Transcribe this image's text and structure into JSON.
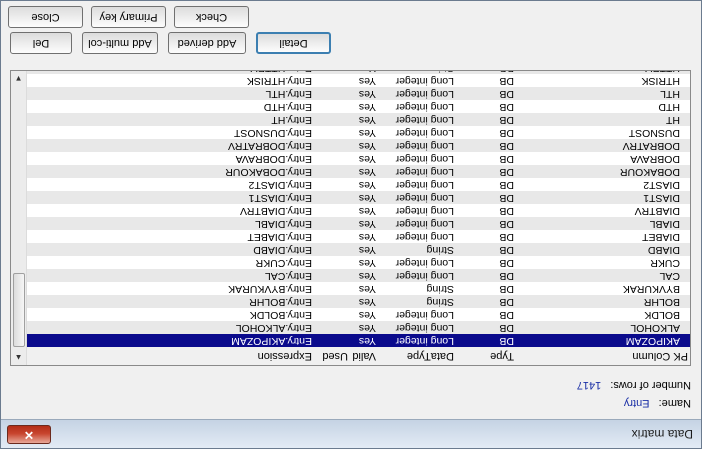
{
  "window": {
    "title": "Data matrix",
    "close_glyph": "✕"
  },
  "info": {
    "name_label": "Name:",
    "name_value": "Entry",
    "rows_label": "Number of rows:",
    "rows_value": "1417"
  },
  "columns": {
    "name": "PK  Column",
    "type": "Type",
    "datatype": "DataType",
    "valid": "Valid",
    "used": "Used",
    "expression": "Expression"
  },
  "rows": [
    {
      "name": "AKIPOZAM",
      "type": "DB",
      "datatype": "Long integer",
      "valid": "Yes",
      "used": "",
      "expression": "Entry.AKIPOZAM",
      "selected": true
    },
    {
      "name": "ALKOHOL",
      "type": "DB",
      "datatype": "Long integer",
      "valid": "Yes",
      "used": "",
      "expression": "Entry.ALKOHOL"
    },
    {
      "name": "BOLDK",
      "type": "DB",
      "datatype": "Long integer",
      "valid": "Yes",
      "used": "",
      "expression": "Entry.BOLDK"
    },
    {
      "name": "BOLHR",
      "type": "DB",
      "datatype": "String",
      "valid": "Yes",
      "used": "",
      "expression": "Entry.BOLHR"
    },
    {
      "name": "BYVKURAK",
      "type": "DB",
      "datatype": "String",
      "valid": "Yes",
      "used": "",
      "expression": "Entry.BYVKURAK"
    },
    {
      "name": "CAL",
      "type": "DB",
      "datatype": "Long integer",
      "valid": "Yes",
      "used": "",
      "expression": "Entry.CAL"
    },
    {
      "name": "CUKR",
      "type": "DB",
      "datatype": "Long integer",
      "valid": "Yes",
      "used": "",
      "expression": "Entry.CUKR"
    },
    {
      "name": "DIABD",
      "type": "DB",
      "datatype": "String",
      "valid": "Yes",
      "used": "",
      "expression": "Entry.DIABD"
    },
    {
      "name": "DIABET",
      "type": "DB",
      "datatype": "Long integer",
      "valid": "Yes",
      "used": "",
      "expression": "Entry.DIABET"
    },
    {
      "name": "DIABL",
      "type": "DB",
      "datatype": "Long integer",
      "valid": "Yes",
      "used": "",
      "expression": "Entry.DIABL"
    },
    {
      "name": "DIABTRV",
      "type": "DB",
      "datatype": "Long integer",
      "valid": "Yes",
      "used": "",
      "expression": "Entry.DIABTRV"
    },
    {
      "name": "DIAST1",
      "type": "DB",
      "datatype": "Long integer",
      "valid": "Yes",
      "used": "",
      "expression": "Entry.DIAST1"
    },
    {
      "name": "DIAST2",
      "type": "DB",
      "datatype": "Long integer",
      "valid": "Yes",
      "used": "",
      "expression": "Entry.DIAST2"
    },
    {
      "name": "DOBAKOUR",
      "type": "DB",
      "datatype": "Long integer",
      "valid": "Yes",
      "used": "",
      "expression": "Entry.DOBAKOUR"
    },
    {
      "name": "DOBRAVA",
      "type": "DB",
      "datatype": "Long integer",
      "valid": "Yes",
      "used": "",
      "expression": "Entry.DOBRAVA"
    },
    {
      "name": "DOBRATRV",
      "type": "DB",
      "datatype": "Long integer",
      "valid": "Yes",
      "used": "",
      "expression": "Entry.DOBRATRV"
    },
    {
      "name": "DUSNOST",
      "type": "DB",
      "datatype": "Long integer",
      "valid": "Yes",
      "used": "",
      "expression": "Entry.DUSNOST"
    },
    {
      "name": "HT",
      "type": "DB",
      "datatype": "Long integer",
      "valid": "Yes",
      "used": "",
      "expression": "Entry.HT"
    },
    {
      "name": "HTD",
      "type": "DB",
      "datatype": "Long integer",
      "valid": "Yes",
      "used": "",
      "expression": "Entry.HTD"
    },
    {
      "name": "HTL",
      "type": "DB",
      "datatype": "Long integer",
      "valid": "Yes",
      "used": "",
      "expression": "Entry.HTL"
    },
    {
      "name": "HTRISK",
      "type": "DB",
      "datatype": "Long integer",
      "valid": "Yes",
      "used": "",
      "expression": "Entry.HTRISK"
    },
    {
      "name": "HTTRV",
      "type": "DB",
      "datatype": "String",
      "valid": "Yes",
      "used": "",
      "expression": "Entry.HTTRV"
    }
  ],
  "buttons": {
    "detail": "Detail",
    "add_derived": "Add derived",
    "add_multi_col": "Add multi-col",
    "del": "Del",
    "close": "Close",
    "primary_key": "Primary key",
    "check": "Check"
  }
}
